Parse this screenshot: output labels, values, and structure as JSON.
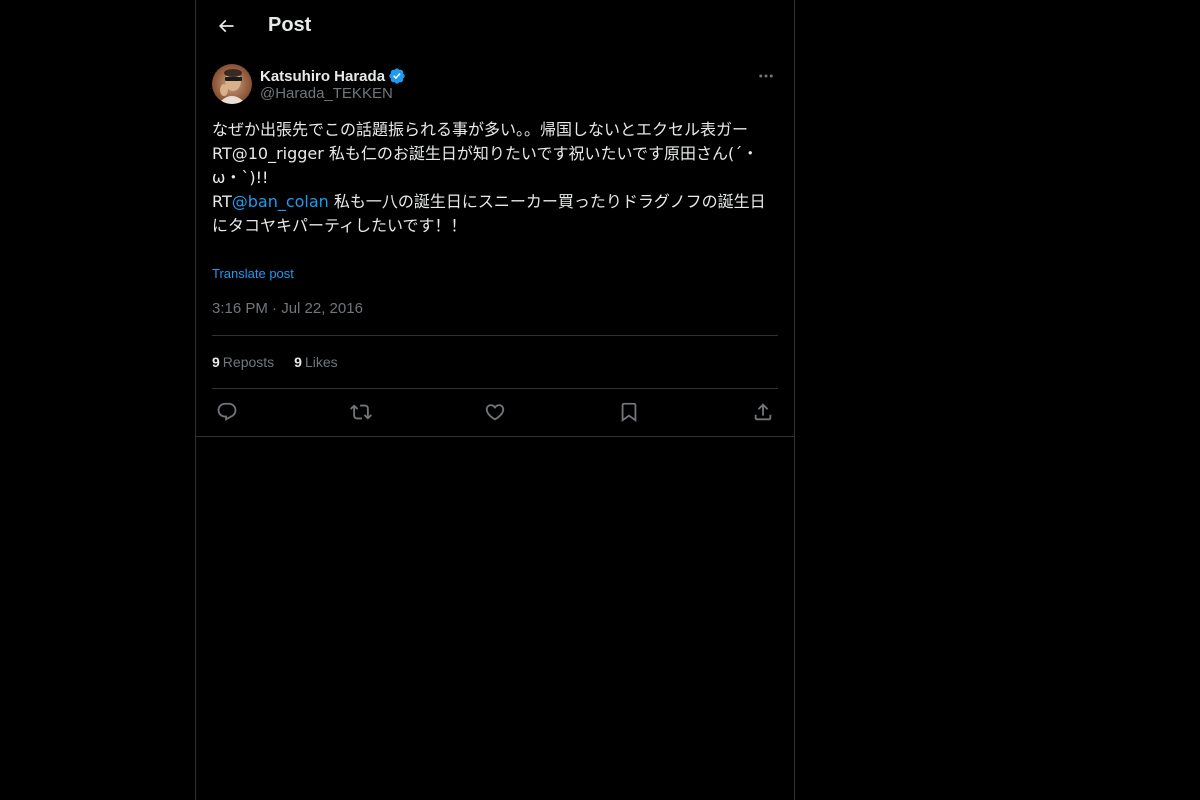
{
  "header": {
    "title": "Post",
    "back_icon": "arrow-left-icon"
  },
  "post": {
    "author": {
      "name": "Katsuhiro Harada",
      "handle": "@Harada_TEKKEN",
      "verified": true
    },
    "text": {
      "line1": "なぜか出張先でこの話題振られる事が多い。。帰国しないとエクセル表ガー",
      "line2": "RT@10_rigger 私も仁のお誕生日が知りたいです祝いたいです原田さん(´・ω・`)!!",
      "line3_prefix": "RT",
      "line3_mention": "@ban_colan",
      "line3_rest": " 私も一八の誕生日にスニーカー買ったりドラグノフの誕生日にタコヤキパーティしたいです！！"
    },
    "translate_label": "Translate post",
    "timestamp": "3:16 PM · Jul 22, 2016",
    "stats": {
      "reposts_count": "9",
      "reposts_label": "Reposts",
      "likes_count": "9",
      "likes_label": "Likes"
    }
  },
  "colors": {
    "background": "#000000",
    "text": "#e7e9ea",
    "secondary": "#71767b",
    "accent": "#1d9bf0",
    "border": "#2f3336"
  },
  "icons": {
    "more": "more-horizontal-icon",
    "reply": "reply-icon",
    "repost": "repost-icon",
    "like": "heart-icon",
    "bookmark": "bookmark-icon",
    "share": "share-icon",
    "verified": "verified-badge-icon"
  }
}
